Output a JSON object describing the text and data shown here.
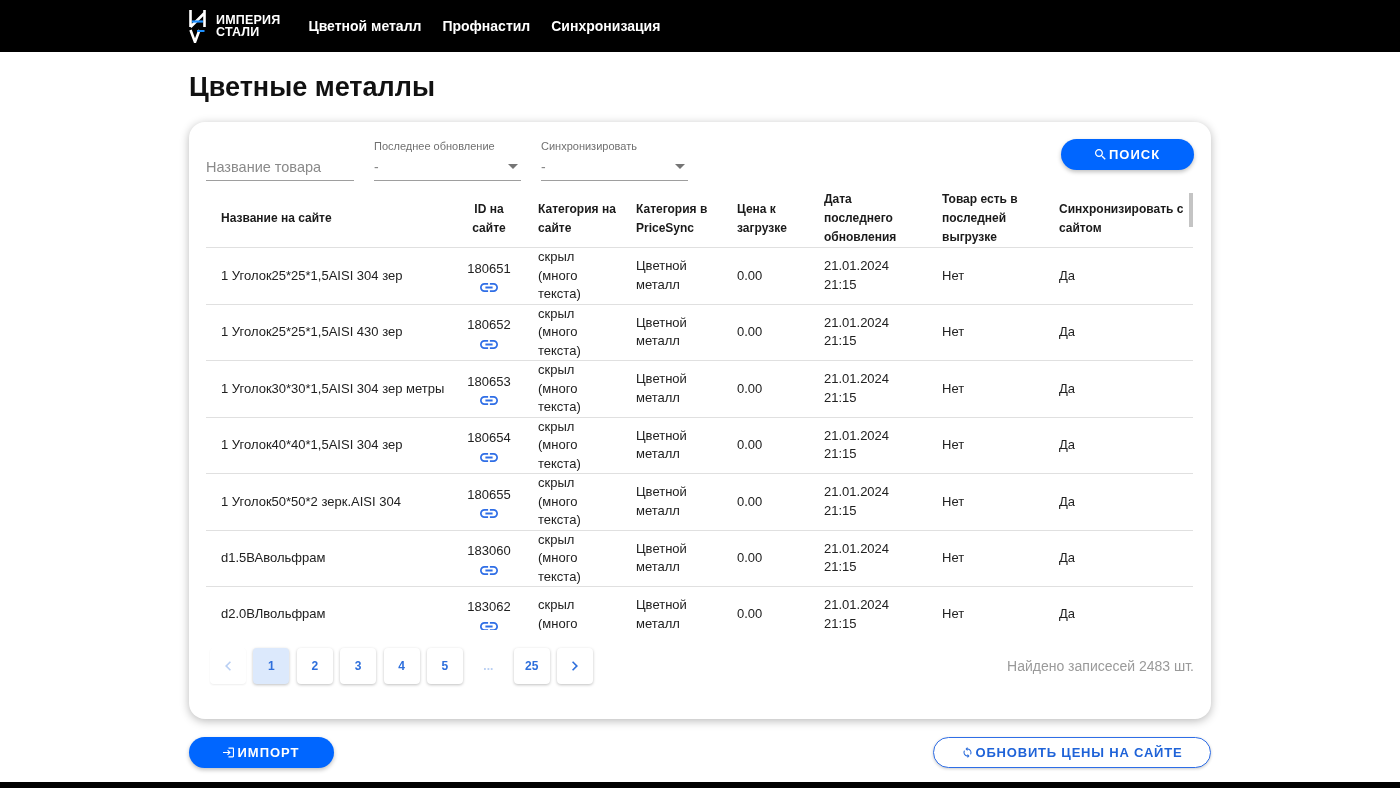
{
  "navbar": {
    "logo": {
      "lines": [
        "ИМПЕРИЯ",
        "СТАЛИ"
      ]
    },
    "links": [
      {
        "label": "Цветной металл"
      },
      {
        "label": "Профнастил"
      },
      {
        "label": "Синхронизация"
      }
    ]
  },
  "page": {
    "title": "Цветные металлы"
  },
  "filters": {
    "name_field": {
      "placeholder": "Название товара"
    },
    "selects": [
      {
        "label": "Последнее обновление",
        "value": "-"
      },
      {
        "label": "Синхронизировать",
        "value": "-"
      }
    ],
    "search_button": "ПОИСК"
  },
  "table": {
    "columns": [
      "Название на сайте",
      "ID на сайте",
      "Категория на сайте",
      "Категория в PriceSync",
      "Цена к загрузке",
      "Дата последнего обновления",
      "Товар есть в последней выгрузке",
      "Синхронизировать с сайтом"
    ],
    "rows": [
      {
        "name": "1 Уголок25*25*1,5AISI 304 зер",
        "id": "180651",
        "site_category": "скрыл (много текста)",
        "pricesync_category": "Цветной металл",
        "price": "0.00",
        "updated": "21.01.2024 21:15",
        "in_last_export": "Нет",
        "sync": "Да"
      },
      {
        "name": "1 Уголок25*25*1,5AISI 430 зер",
        "id": "180652",
        "site_category": "скрыл (много текста)",
        "pricesync_category": "Цветной металл",
        "price": "0.00",
        "updated": "21.01.2024 21:15",
        "in_last_export": "Нет",
        "sync": "Да"
      },
      {
        "name": "1 Уголок30*30*1,5AISI 304 зер метры",
        "id": "180653",
        "site_category": "скрыл (много текста)",
        "pricesync_category": "Цветной металл",
        "price": "0.00",
        "updated": "21.01.2024 21:15",
        "in_last_export": "Нет",
        "sync": "Да"
      },
      {
        "name": "1 Уголок40*40*1,5AISI 304 зер",
        "id": "180654",
        "site_category": "скрыл (много текста)",
        "pricesync_category": "Цветной металл",
        "price": "0.00",
        "updated": "21.01.2024 21:15",
        "in_last_export": "Нет",
        "sync": "Да"
      },
      {
        "name": "1 Уголок50*50*2 зерк.AISI 304",
        "id": "180655",
        "site_category": "скрыл (много текста)",
        "pricesync_category": "Цветной металл",
        "price": "0.00",
        "updated": "21.01.2024 21:15",
        "in_last_export": "Нет",
        "sync": "Да"
      },
      {
        "name": "d1.5ВАвольфрам",
        "id": "183060",
        "site_category": "скрыл (много текста)",
        "pricesync_category": "Цветной металл",
        "price": "0.00",
        "updated": "21.01.2024 21:15",
        "in_last_export": "Нет",
        "sync": "Да"
      },
      {
        "name": "d2.0ВЛвольфрам",
        "id": "183062",
        "site_category": "скрыл (много",
        "pricesync_category": "Цветной металл",
        "price": "0.00",
        "updated": "21.01.2024 21:15",
        "in_last_export": "Нет",
        "sync": "Да"
      }
    ]
  },
  "pagination": {
    "items": [
      {
        "kind": "prev",
        "selected": false,
        "disabled": true
      },
      {
        "kind": "page",
        "label": "1",
        "selected": true,
        "disabled": false
      },
      {
        "kind": "page",
        "label": "2",
        "selected": false,
        "disabled": false
      },
      {
        "kind": "page",
        "label": "3",
        "selected": false,
        "disabled": false
      },
      {
        "kind": "page",
        "label": "4",
        "selected": false,
        "disabled": false
      },
      {
        "kind": "page",
        "label": "5",
        "selected": false,
        "disabled": false
      },
      {
        "kind": "ellipsis",
        "label": "...",
        "selected": false,
        "disabled": true
      },
      {
        "kind": "page",
        "label": "25",
        "selected": false,
        "disabled": false
      },
      {
        "kind": "next",
        "selected": false,
        "disabled": false
      }
    ],
    "total": "Найдено записесей 2483 шт."
  },
  "actions": {
    "import_button": "ИМПОРТ",
    "update_button": "ОБНОВИТЬ ЦЕНЫ НА САЙТЕ"
  }
}
